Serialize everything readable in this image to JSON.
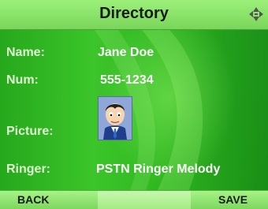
{
  "header": {
    "title": "Directory",
    "nav_icon": "updown-leftright-arrows-icon"
  },
  "fields": {
    "name": {
      "label": "Name:",
      "value": "Jane Doe"
    },
    "number": {
      "label": "Num:",
      "value": "555-1234"
    },
    "picture": {
      "label": "Picture:",
      "icon": "contact-avatar-icon"
    },
    "ringer": {
      "label": "Ringer:",
      "value": "PSTN Ringer Melody"
    }
  },
  "softkeys": {
    "left": "BACK",
    "middle": "",
    "right": "SAVE"
  },
  "colors": {
    "header": "#8be46c",
    "content": "#2fb720",
    "text": "#ffffff"
  }
}
